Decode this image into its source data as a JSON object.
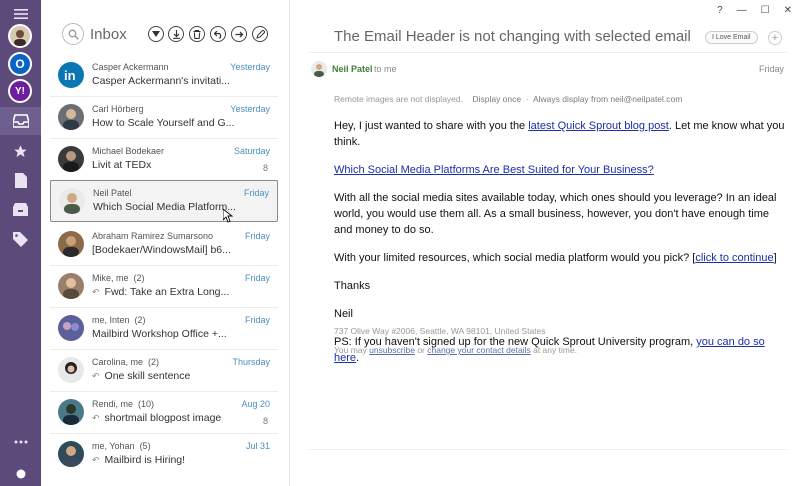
{
  "rail": {
    "accounts": [
      {
        "name": "linkedin-account",
        "glyph": "in",
        "color": "#0b76b4"
      },
      {
        "name": "outlook-account",
        "glyph": "O",
        "color": "#0a64c8"
      },
      {
        "name": "yahoo-account",
        "glyph": "Y!",
        "color": "#6b1fa0"
      }
    ],
    "nav_icons": [
      "inbox-icon",
      "star-icon",
      "document-icon",
      "archive-icon",
      "tag-icon"
    ],
    "bottom_icons": [
      "more-icon",
      "status-icon"
    ]
  },
  "list": {
    "title": "Inbox",
    "toolbar_icons": [
      "dropdown-icon",
      "download-icon",
      "delete-icon",
      "reply-icon",
      "forward-icon",
      "compose-icon"
    ],
    "messages": [
      {
        "sender": "Casper Ackermann",
        "date": "Yesterday",
        "subject": "Casper Ackermann's invitati...",
        "count": "",
        "reply": false,
        "avatar_color": "#0b76b4"
      },
      {
        "sender": "Carl Hörberg",
        "date": "Yesterday",
        "subject": "How to Scale Yourself and G...",
        "count": "",
        "reply": false,
        "avatar_color": "#6b6f74"
      },
      {
        "sender": "Michael Bodekaer",
        "date": "Saturday",
        "subject": "Livit at TEDx",
        "count": "8",
        "reply": false,
        "avatar_color": "#3a3a3a"
      },
      {
        "sender": "Neil Patel",
        "date": "Friday",
        "subject": "Which Social Media Platform...",
        "count": "",
        "reply": false,
        "avatar_color": "#7c8a74"
      },
      {
        "sender": "Abraham Ramirez Sumarsono",
        "date": "Friday",
        "subject": "[Bodekaer/WindowsMail] b6...",
        "count": "",
        "reply": false,
        "avatar_color": "#8a6a4a"
      },
      {
        "sender": "Mike, me",
        "count_label": "(2)",
        "date": "Friday",
        "subject": "Fwd: Take an Extra Long...",
        "count": "",
        "reply": true,
        "avatar_color": "#9a7f6a"
      },
      {
        "sender": "me, Inten",
        "count_label": "(2)",
        "date": "Friday",
        "subject": "Mailbird Workshop Office +...",
        "count": "",
        "reply": false,
        "avatar_color": "#5b5f9a"
      },
      {
        "sender": "Carolina, me",
        "count_label": "(2)",
        "date": "Thursday",
        "subject": "One skill sentence",
        "count": "",
        "reply": true,
        "avatar_color": "#3b3b3b"
      },
      {
        "sender": "Rendi, me",
        "count_label": "(10)",
        "date": "Aug 20",
        "subject": "shortmail blogpost image",
        "count": "8",
        "reply": true,
        "avatar_color": "#4a7a8a"
      },
      {
        "sender": "me, Yohan",
        "count_label": "(5)",
        "date": "Jul 31",
        "subject": "Mailbird is Hiring!",
        "count": "",
        "reply": true,
        "avatar_color": "#2f4a5a"
      }
    ]
  },
  "reader": {
    "window_controls": [
      "?",
      "—",
      "☐",
      "✕"
    ],
    "subject": "The Email Header is not changing with selected email [B...",
    "label": "I Love Email",
    "from_name": "Neil Patel",
    "from_to": "to me",
    "date": "Friday",
    "remote_note": "Remote images are not displayed.",
    "display_once": "Display once",
    "always_display": "Always display from neil@neilpatel.com",
    "body": {
      "p1_before": "Hey, I just wanted to share with you the ",
      "p1_link": "latest Quick Sprout blog post",
      "p1_after": ". Let me know what you think.",
      "p2_link": "Which Social Media Platforms Are Best Suited for Your Business?",
      "p3": "With all the social media sites available today, which ones should you leverage? In an ideal world, you would use them all. As a small business, however, you don't have enough time and money to do so.",
      "p4_before": "With your limited resources, which social media platform would you pick? [",
      "p4_link": "click to continue",
      "p4_after": "]",
      "p5": "Thanks",
      "p6": "Neil",
      "p7_before": "PS: If you haven't signed up for the new Quick Sprout University program, ",
      "p7_link": "you can do so here",
      "p7_after": "."
    },
    "footer_address": "737 Olive Way #2006, Seattle, WA 98101, United States",
    "footer_prefix": "You may ",
    "unsubscribe": "unsubscribe",
    "footer_or": " or ",
    "change_details": "change your contact details",
    "footer_suffix": " at any time."
  }
}
